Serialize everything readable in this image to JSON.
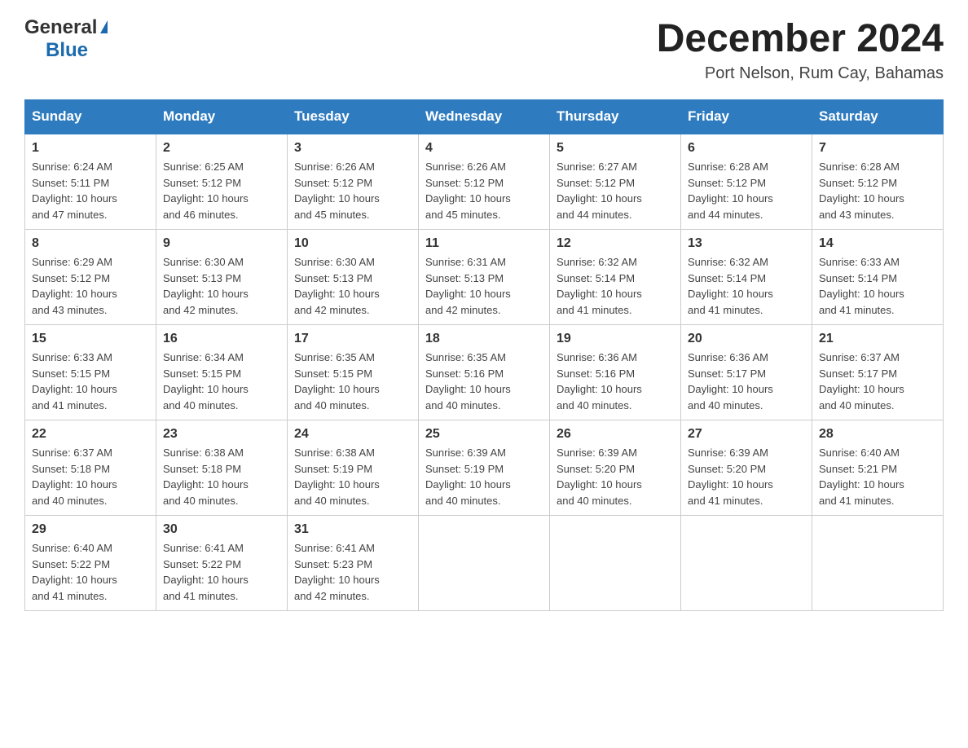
{
  "header": {
    "logo_general": "General",
    "logo_blue": "Blue",
    "title": "December 2024",
    "subtitle": "Port Nelson, Rum Cay, Bahamas"
  },
  "days_header": [
    "Sunday",
    "Monday",
    "Tuesday",
    "Wednesday",
    "Thursday",
    "Friday",
    "Saturday"
  ],
  "weeks": [
    [
      {
        "day": "1",
        "info": "Sunrise: 6:24 AM\nSunset: 5:11 PM\nDaylight: 10 hours\nand 47 minutes."
      },
      {
        "day": "2",
        "info": "Sunrise: 6:25 AM\nSunset: 5:12 PM\nDaylight: 10 hours\nand 46 minutes."
      },
      {
        "day": "3",
        "info": "Sunrise: 6:26 AM\nSunset: 5:12 PM\nDaylight: 10 hours\nand 45 minutes."
      },
      {
        "day": "4",
        "info": "Sunrise: 6:26 AM\nSunset: 5:12 PM\nDaylight: 10 hours\nand 45 minutes."
      },
      {
        "day": "5",
        "info": "Sunrise: 6:27 AM\nSunset: 5:12 PM\nDaylight: 10 hours\nand 44 minutes."
      },
      {
        "day": "6",
        "info": "Sunrise: 6:28 AM\nSunset: 5:12 PM\nDaylight: 10 hours\nand 44 minutes."
      },
      {
        "day": "7",
        "info": "Sunrise: 6:28 AM\nSunset: 5:12 PM\nDaylight: 10 hours\nand 43 minutes."
      }
    ],
    [
      {
        "day": "8",
        "info": "Sunrise: 6:29 AM\nSunset: 5:12 PM\nDaylight: 10 hours\nand 43 minutes."
      },
      {
        "day": "9",
        "info": "Sunrise: 6:30 AM\nSunset: 5:13 PM\nDaylight: 10 hours\nand 42 minutes."
      },
      {
        "day": "10",
        "info": "Sunrise: 6:30 AM\nSunset: 5:13 PM\nDaylight: 10 hours\nand 42 minutes."
      },
      {
        "day": "11",
        "info": "Sunrise: 6:31 AM\nSunset: 5:13 PM\nDaylight: 10 hours\nand 42 minutes."
      },
      {
        "day": "12",
        "info": "Sunrise: 6:32 AM\nSunset: 5:14 PM\nDaylight: 10 hours\nand 41 minutes."
      },
      {
        "day": "13",
        "info": "Sunrise: 6:32 AM\nSunset: 5:14 PM\nDaylight: 10 hours\nand 41 minutes."
      },
      {
        "day": "14",
        "info": "Sunrise: 6:33 AM\nSunset: 5:14 PM\nDaylight: 10 hours\nand 41 minutes."
      }
    ],
    [
      {
        "day": "15",
        "info": "Sunrise: 6:33 AM\nSunset: 5:15 PM\nDaylight: 10 hours\nand 41 minutes."
      },
      {
        "day": "16",
        "info": "Sunrise: 6:34 AM\nSunset: 5:15 PM\nDaylight: 10 hours\nand 40 minutes."
      },
      {
        "day": "17",
        "info": "Sunrise: 6:35 AM\nSunset: 5:15 PM\nDaylight: 10 hours\nand 40 minutes."
      },
      {
        "day": "18",
        "info": "Sunrise: 6:35 AM\nSunset: 5:16 PM\nDaylight: 10 hours\nand 40 minutes."
      },
      {
        "day": "19",
        "info": "Sunrise: 6:36 AM\nSunset: 5:16 PM\nDaylight: 10 hours\nand 40 minutes."
      },
      {
        "day": "20",
        "info": "Sunrise: 6:36 AM\nSunset: 5:17 PM\nDaylight: 10 hours\nand 40 minutes."
      },
      {
        "day": "21",
        "info": "Sunrise: 6:37 AM\nSunset: 5:17 PM\nDaylight: 10 hours\nand 40 minutes."
      }
    ],
    [
      {
        "day": "22",
        "info": "Sunrise: 6:37 AM\nSunset: 5:18 PM\nDaylight: 10 hours\nand 40 minutes."
      },
      {
        "day": "23",
        "info": "Sunrise: 6:38 AM\nSunset: 5:18 PM\nDaylight: 10 hours\nand 40 minutes."
      },
      {
        "day": "24",
        "info": "Sunrise: 6:38 AM\nSunset: 5:19 PM\nDaylight: 10 hours\nand 40 minutes."
      },
      {
        "day": "25",
        "info": "Sunrise: 6:39 AM\nSunset: 5:19 PM\nDaylight: 10 hours\nand 40 minutes."
      },
      {
        "day": "26",
        "info": "Sunrise: 6:39 AM\nSunset: 5:20 PM\nDaylight: 10 hours\nand 40 minutes."
      },
      {
        "day": "27",
        "info": "Sunrise: 6:39 AM\nSunset: 5:20 PM\nDaylight: 10 hours\nand 41 minutes."
      },
      {
        "day": "28",
        "info": "Sunrise: 6:40 AM\nSunset: 5:21 PM\nDaylight: 10 hours\nand 41 minutes."
      }
    ],
    [
      {
        "day": "29",
        "info": "Sunrise: 6:40 AM\nSunset: 5:22 PM\nDaylight: 10 hours\nand 41 minutes."
      },
      {
        "day": "30",
        "info": "Sunrise: 6:41 AM\nSunset: 5:22 PM\nDaylight: 10 hours\nand 41 minutes."
      },
      {
        "day": "31",
        "info": "Sunrise: 6:41 AM\nSunset: 5:23 PM\nDaylight: 10 hours\nand 42 minutes."
      },
      {
        "day": "",
        "info": ""
      },
      {
        "day": "",
        "info": ""
      },
      {
        "day": "",
        "info": ""
      },
      {
        "day": "",
        "info": ""
      }
    ]
  ]
}
